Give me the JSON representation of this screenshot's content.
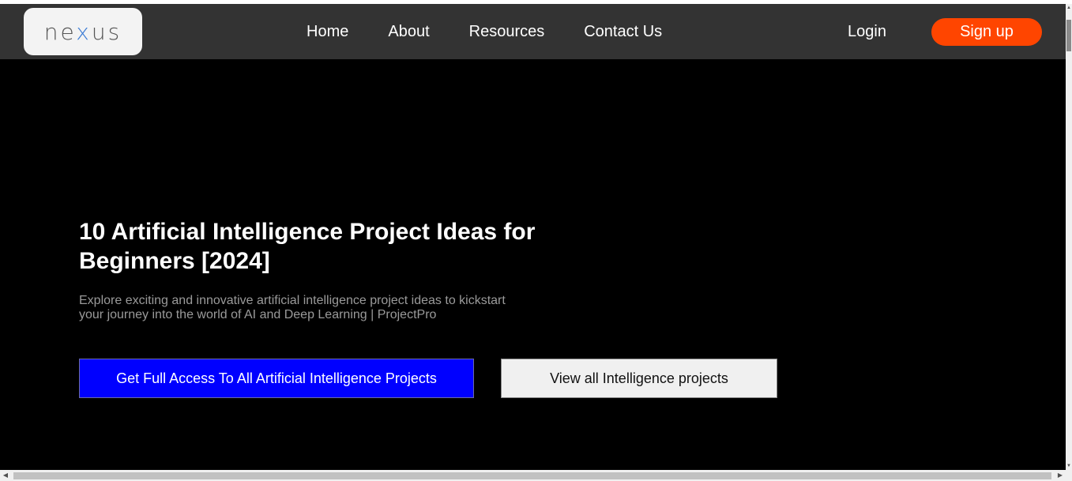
{
  "nav": {
    "logo": "nexus",
    "links": [
      "Home",
      "About",
      "Resources",
      "Contact Us"
    ],
    "login_label": "Login",
    "signup_label": "Sign up"
  },
  "hero": {
    "title": "10 Artificial Intelligence Project Ideas for Beginners [2024]",
    "description": "Explore exciting and innovative artificial intelligence project ideas to kickstart your journey into the world of AI and Deep Learning | ProjectPro",
    "primary_cta": "Get Full Access To All Artificial Intelligence Projects",
    "secondary_cta": "View all Intelligence projects"
  },
  "colors": {
    "navbar_bg": "#333333",
    "hero_bg": "#000000",
    "signup_bg": "#ff4500",
    "primary_cta_bg": "#0000ff",
    "secondary_cta_bg": "#f0f0f0"
  },
  "icons": {
    "scroll_up": "triangle-up-icon",
    "scroll_down": "triangle-down-icon",
    "scroll_left": "triangle-left-icon",
    "scroll_right": "triangle-right-icon"
  }
}
